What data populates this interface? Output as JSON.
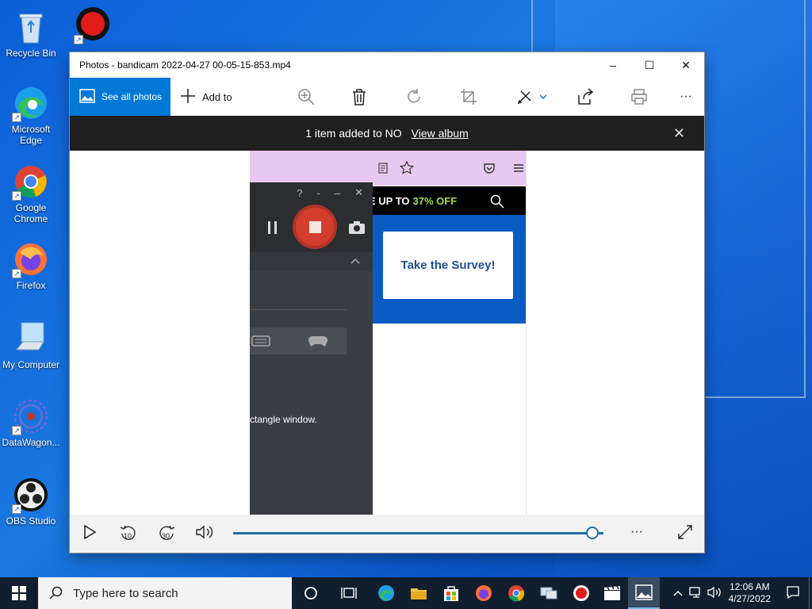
{
  "desktop": {
    "icons": [
      {
        "label": "Recycle Bin",
        "icon": "recycle-bin-icon"
      },
      {
        "label": "Bandicam",
        "icon": "bandicam-icon"
      },
      {
        "label": "Microsoft Edge",
        "icon": "edge-icon"
      },
      {
        "label": "Google Chrome",
        "icon": "chrome-icon"
      },
      {
        "label": "Firefox",
        "icon": "firefox-icon"
      },
      {
        "label": "My Computer",
        "icon": "computer-icon"
      },
      {
        "label": "DataWagon...",
        "icon": "datawagon-icon"
      },
      {
        "label": "OBS Studio",
        "icon": "obs-icon"
      }
    ]
  },
  "window": {
    "title": "Photos - bandicam 2022-04-27 00-05-15-853.mp4",
    "minimize": "–",
    "maximize": "☐",
    "close": "✕"
  },
  "toolbar": {
    "see_all_photos": "See all photos",
    "add_to": "Add to",
    "more": "···"
  },
  "notification": {
    "text": "1 item added to NO",
    "link": "View album",
    "close": "✕"
  },
  "video_frame": {
    "promo_text": "E UP TO",
    "promo_highlight": "37% OFF",
    "survey_button": "Take the Survey!",
    "bandicam_message": "ctangle window.",
    "bandicam_help": "?",
    "bandicam_dash": "-",
    "bandicam_min": "–",
    "bandicam_close": "✕"
  },
  "player": {
    "progress": 0.97,
    "skip_back": "10",
    "skip_forward": "30",
    "more": "···"
  },
  "taskbar": {
    "search_placeholder": "Type here to search",
    "time": "12:06 AM",
    "date": "4/27/2022"
  },
  "colors": {
    "accent": "#0078d7",
    "record_red": "#d23d2e",
    "promo_green": "#9be24c",
    "survey_blue": "#0a5bc4"
  }
}
